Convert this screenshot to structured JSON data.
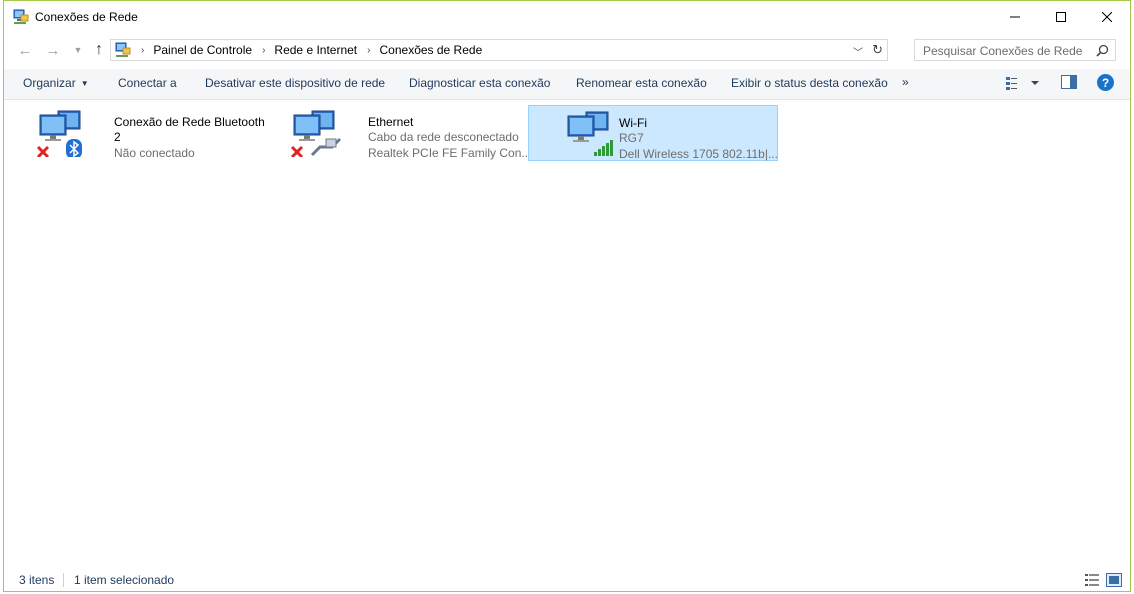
{
  "window": {
    "title": "Conexões de Rede",
    "controls": {
      "minimize": "minimize",
      "maximize": "maximize",
      "close": "close"
    }
  },
  "address": {
    "breadcrumbs": [
      "Painel de Controle",
      "Rede e Internet",
      "Conexões de Rede"
    ]
  },
  "search": {
    "placeholder": "Pesquisar Conexões de Rede"
  },
  "toolbar": {
    "organize": "Organizar",
    "connect": "Conectar a",
    "disable": "Desativar este dispositivo de rede",
    "diagnose": "Diagnosticar esta conexão",
    "rename": "Renomear esta conexão",
    "status": "Exibir o status desta conexão",
    "more": "»"
  },
  "items": [
    {
      "name": "Conexão de Rede Bluetooth",
      "name2": "2",
      "status": "Não conectado",
      "overlay": "bluetooth-icon",
      "error": true
    },
    {
      "name": "Ethernet",
      "status": "Cabo da rede desconectado",
      "device": "Realtek PCIe FE Family Con...",
      "overlay": "ethernet-cable-icon",
      "error": true
    },
    {
      "name": "Wi-Fi",
      "status": "RG7",
      "device": "Dell Wireless 1705 802.11b|...",
      "overlay": "wifi-signal-icon",
      "error": false,
      "selected": true
    }
  ],
  "statusbar": {
    "count": "3 itens",
    "selected": "1 item selecionado"
  },
  "colors": {
    "selection_bg": "#cce8ff",
    "selection_border": "#99d1ff",
    "window_border": "#a4c84a",
    "link_text": "#1e395b"
  }
}
